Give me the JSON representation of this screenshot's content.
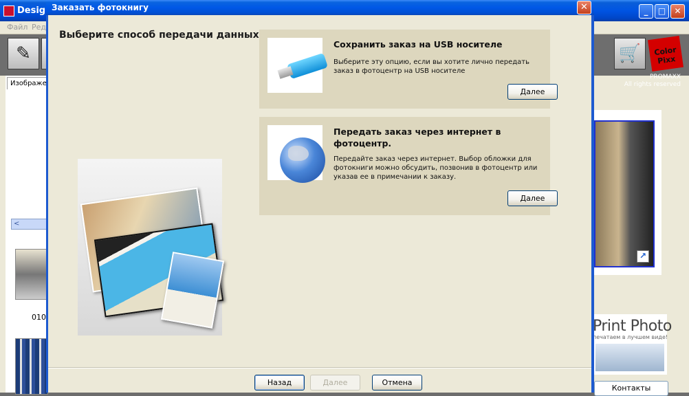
{
  "app": {
    "title": "Design",
    "menu": [
      "Файл",
      "Ред"
    ],
    "left_tab_label": "Изображе",
    "thumb_label": "010",
    "brand_line1": "PROMAXX",
    "brand_line2": "All rights reserved",
    "logo_text": "Color Pixx",
    "print_photo_title": "Print Photo",
    "print_photo_sub": "печатаем в лучшем виде!",
    "contacts_label": "Контакты"
  },
  "dialog": {
    "title": "Заказать фотокнигу",
    "heading": "Выберите способ передачи данных",
    "options": [
      {
        "title": "Сохранить заказ на USB носителе",
        "description": "Выберите эту опцию, если вы хотите лично передать заказ в фотоцентр на USB носителе",
        "button": "Далее",
        "icon": "usb-drive-icon"
      },
      {
        "title": "Передать заказ через интернет в фотоцентр.",
        "description": "Передайте заказ через интернет. Выбор обложки для фотокниги можно обсудить, позвонив в фотоцентр или указав ее в примечании к заказу.",
        "button": "Далее",
        "icon": "globe-icon"
      }
    ],
    "buttons": {
      "back": "Назад",
      "next": "Далее",
      "cancel": "Отмена"
    }
  },
  "colors": {
    "titlebar": "#0054e3",
    "dialog_bg": "#ece9d8",
    "option_bg": "#ddd7be"
  }
}
